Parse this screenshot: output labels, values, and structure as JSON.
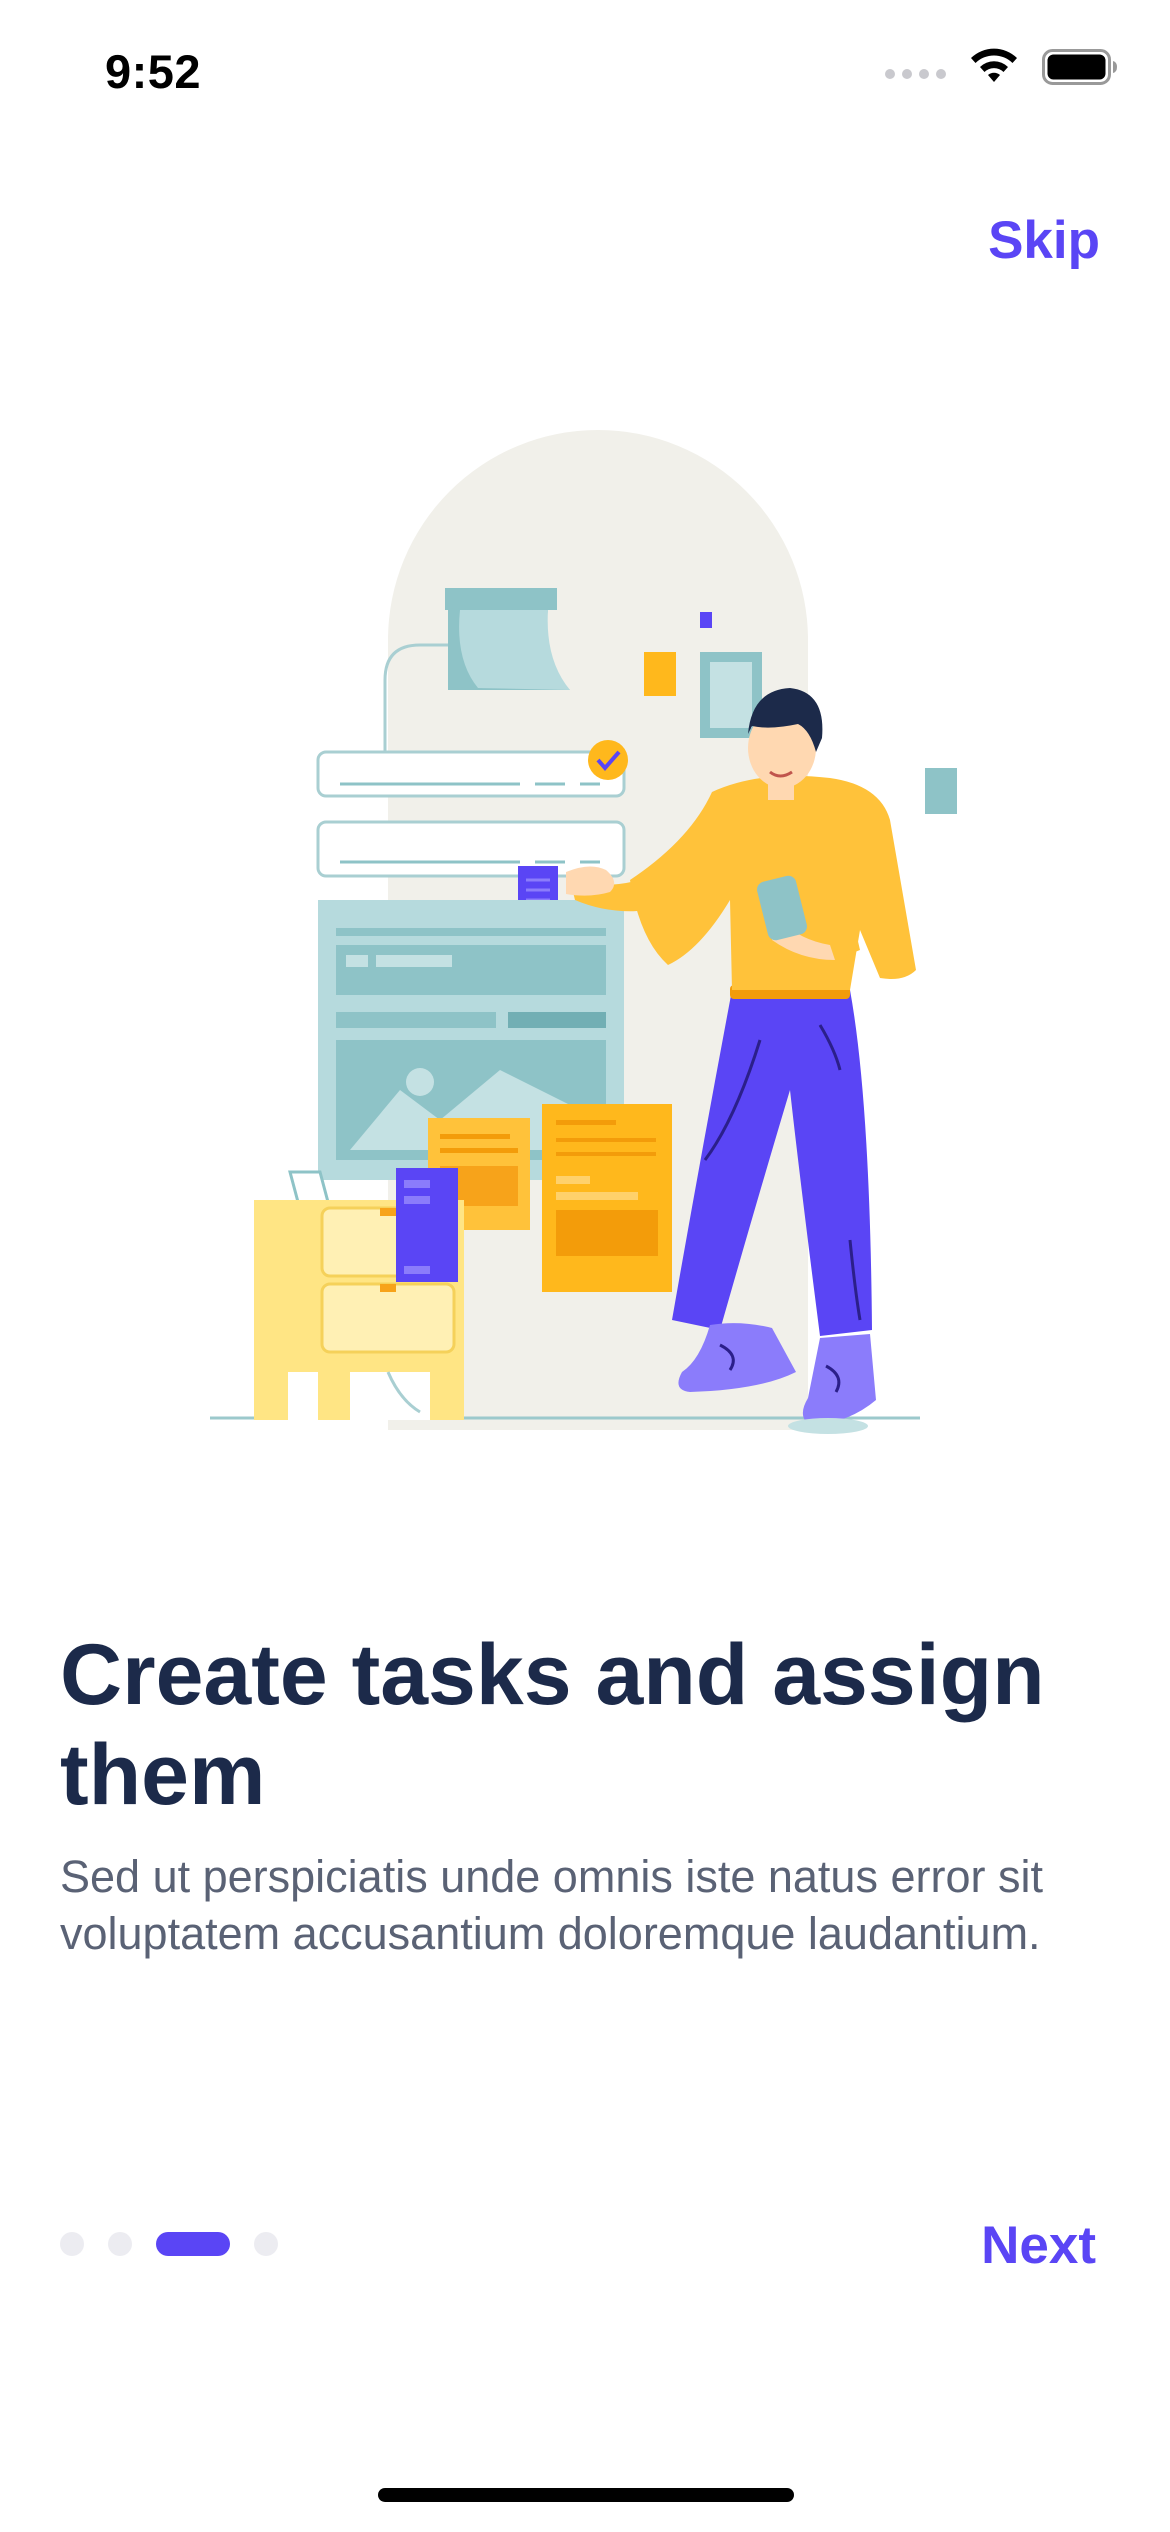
{
  "status_bar": {
    "time": "9:52",
    "icons": [
      "cellular-signal-icon",
      "wifi-icon",
      "battery-icon"
    ]
  },
  "header": {
    "skip_label": "Skip"
  },
  "content": {
    "title": "Create tasks and assign them",
    "description": "Sed ut perspiciatis unde omnis iste natus error sit voluptatem accusantium doloremque laudantium."
  },
  "pagination": {
    "total": 4,
    "active_index": 2
  },
  "footer": {
    "next_label": "Next"
  },
  "colors": {
    "accent": "#5a45f5",
    "title": "#1c2a4a",
    "body_text": "#5a6275",
    "dot_inactive": "#ececf1"
  }
}
